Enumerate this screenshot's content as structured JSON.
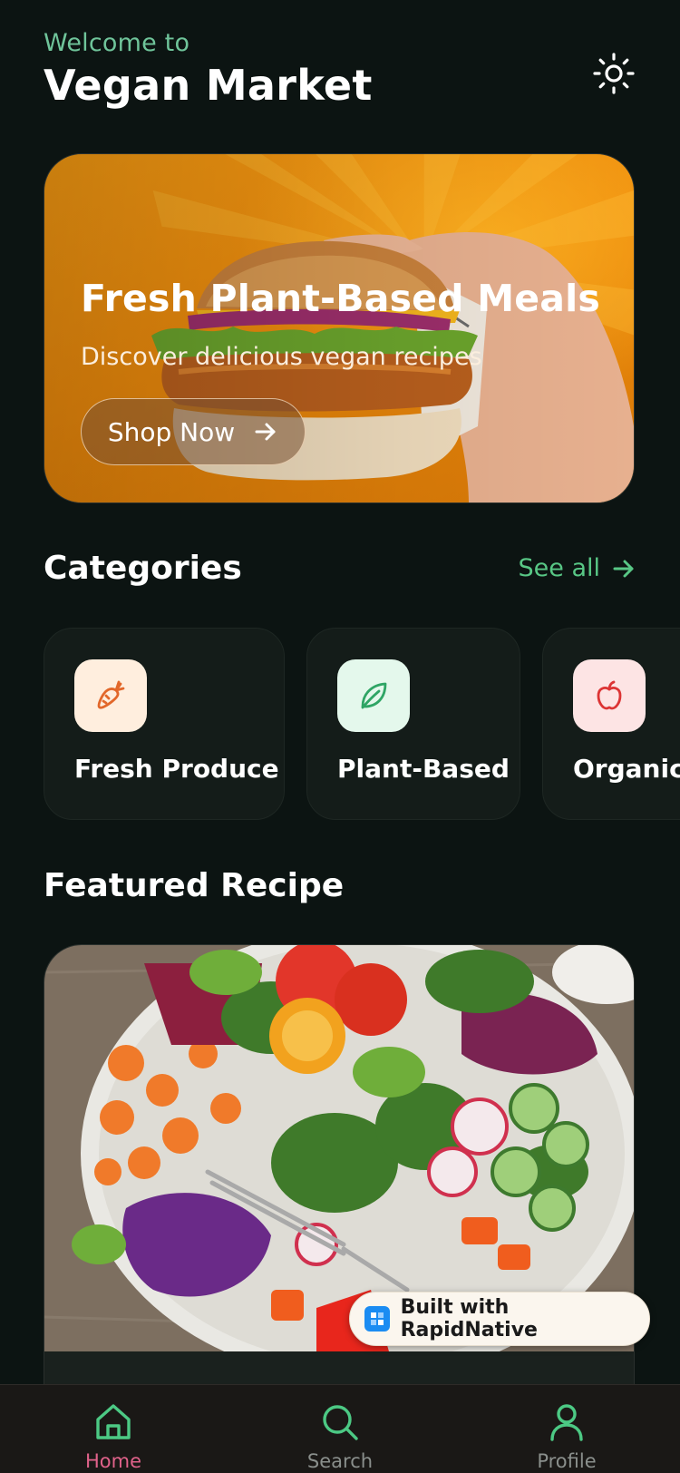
{
  "header": {
    "welcome": "Welcome to",
    "title": "Vegan Market",
    "theme_icon": "sun-icon"
  },
  "hero": {
    "title": "Fresh Plant-Based Meals",
    "subtitle": "Discover delicious vegan recipes",
    "cta_label": "Shop Now",
    "cta_icon": "arrow-right-icon"
  },
  "categories": {
    "title": "Categories",
    "see_all": "See all",
    "items": [
      {
        "label": "Fresh Produce",
        "icon": "carrot-icon",
        "icon_bg": "#ffeede",
        "icon_color": "#e2672a"
      },
      {
        "label": "Plant-Based",
        "icon": "leaf-icon",
        "icon_bg": "#e4f8ec",
        "icon_color": "#2fa565"
      },
      {
        "label": "Organic",
        "icon": "apple-icon",
        "icon_bg": "#fde4e4",
        "icon_color": "#dc3434"
      }
    ]
  },
  "featured": {
    "title": "Featured Recipe"
  },
  "badge": {
    "label": "Built with RapidNative"
  },
  "tabbar": {
    "items": [
      {
        "label": "Home",
        "icon": "home-icon",
        "active": true,
        "color": "#e0628a",
        "icon_color": "#4cc984"
      },
      {
        "label": "Search",
        "icon": "search-icon",
        "active": false,
        "color": "#8a8f8c",
        "icon_color": "#4cc984"
      },
      {
        "label": "Profile",
        "icon": "profile-icon",
        "active": false,
        "color": "#8a8f8c",
        "icon_color": "#4cc984"
      }
    ]
  },
  "colors": {
    "background": "#0c1412",
    "accent": "#58c785",
    "card": "#141c19"
  }
}
